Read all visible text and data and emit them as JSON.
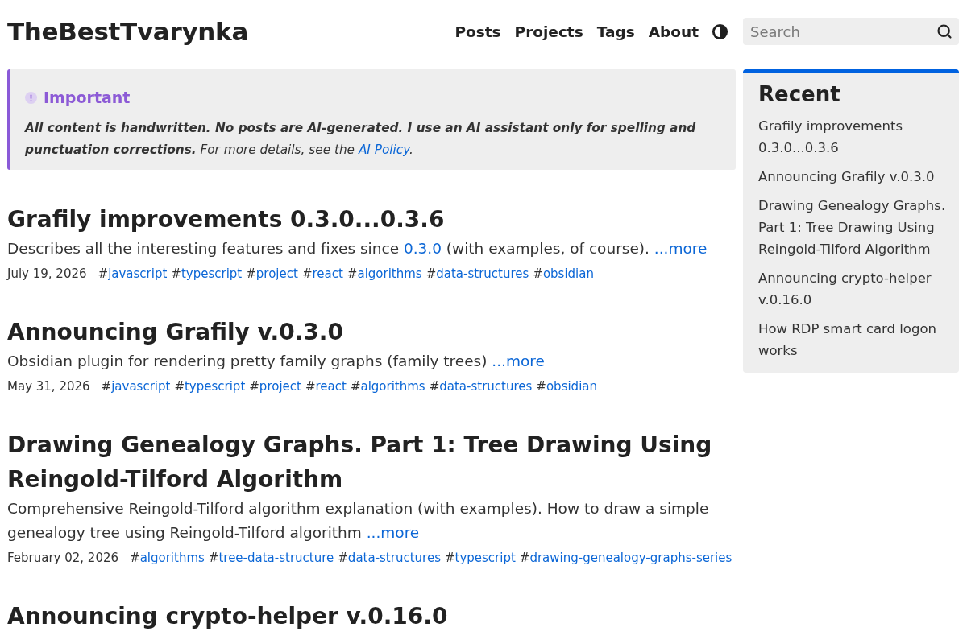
{
  "site_title": "TheBestTvarynka",
  "nav": [
    {
      "label": "Posts"
    },
    {
      "label": "Projects"
    },
    {
      "label": "Tags"
    },
    {
      "label": "About"
    }
  ],
  "search": {
    "placeholder": "Search"
  },
  "callout": {
    "title": "Important",
    "text_before": "**All content is handwritten. No posts are AI-generated. I use an AI assistant only for spelling and punctuation corrections.** For more details, see the ",
    "link": "AI Policy",
    "text_after": "."
  },
  "posts": [
    {
      "title": "Grafily improvements 0.3.0...0.3.6",
      "summary": [
        {
          "kind": "text",
          "text": "Describes all the interesting features and fixes since "
        },
        {
          "kind": "link",
          "text": "0.3.0"
        },
        {
          "kind": "text",
          "text": " (with examples, of course). "
        }
      ],
      "more": "...more",
      "date": "July 19, 2026",
      "tags": [
        {
          "mark": "#",
          "name": "javascript"
        },
        {
          "mark": "#",
          "name": "typescript"
        },
        {
          "mark": "#",
          "name": "project"
        },
        {
          "mark": "#",
          "name": "react"
        },
        {
          "mark": "#",
          "name": "algorithms"
        },
        {
          "mark": "#",
          "name": "data-structures"
        },
        {
          "mark": "#",
          "name": "obsidian"
        }
      ]
    },
    {
      "title": "Announcing Grafily v.0.3.0",
      "summary": [
        {
          "kind": "text",
          "text": "Obsidian plugin for rendering pretty family graphs (family trees) "
        }
      ],
      "more": "...more",
      "date": "May 31, 2026",
      "tags": [
        {
          "mark": "#",
          "name": "javascript"
        },
        {
          "mark": "#",
          "name": "typescript"
        },
        {
          "mark": "#",
          "name": "project"
        },
        {
          "mark": "#",
          "name": "react"
        },
        {
          "mark": "#",
          "name": "algorithms"
        },
        {
          "mark": "#",
          "name": "data-structures"
        },
        {
          "mark": "#",
          "name": "obsidian"
        }
      ]
    },
    {
      "title": "Drawing Genealogy Graphs. Part 1: Tree Drawing Using Reingold-Tilford Algorithm",
      "summary": [
        {
          "kind": "text",
          "text": "Comprehensive Reingold-Tilford algorithm explanation (with examples). How to draw a simple genealogy tree using Reingold-Tilford algorithm "
        }
      ],
      "more": "...more",
      "date": "February 02, 2026",
      "tags": [
        {
          "mark": "#",
          "name": "algorithms"
        },
        {
          "mark": "#",
          "name": "tree-data-structure"
        },
        {
          "mark": "#",
          "name": "data-structures"
        },
        {
          "mark": "#",
          "name": "typescript"
        },
        {
          "mark": "#",
          "name": "drawing-genealogy-graphs-series"
        }
      ]
    },
    {
      "title": "Announcing crypto-helper v.0.16.0"
    }
  ],
  "recent": {
    "title": "Recent",
    "items": [
      {
        "label": "Grafily improvements 0.3.0...0.3.6"
      },
      {
        "label": "Announcing Grafily v.0.3.0"
      },
      {
        "label": "Drawing Genealogy Graphs. Part 1: Tree Drawing Using Reingold-Tilford Algorithm"
      },
      {
        "label": "Announcing crypto-helper v.0.16.0"
      },
      {
        "label": "How RDP smart card logon works"
      }
    ]
  }
}
